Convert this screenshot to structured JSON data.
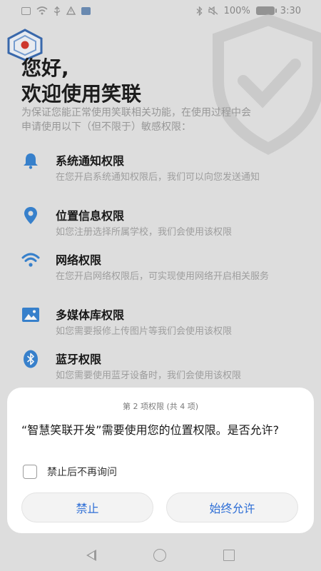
{
  "status_bar": {
    "battery_text": "100%",
    "time": "3:30"
  },
  "greeting": {
    "line1": "您好,",
    "line2": "欢迎使用笑联"
  },
  "intro_text": "为保证您能正常使用笑联相关功能，在使用过程中会申请使用以下（但不限于）敏感权限：",
  "permissions": [
    {
      "title": "系统通知权限",
      "desc": "在您开启系统通知权限后，我们可以向您发送通知",
      "icon": "bell-icon"
    },
    {
      "title": "位置信息权限",
      "desc": "如您注册选择所属学校，我们会使用该权限",
      "icon": "location-pin-icon"
    },
    {
      "title": "网络权限",
      "desc": "在您开启网络权限后，可实现使用网络开启相关服务",
      "icon": "wifi-icon"
    },
    {
      "title": "多媒体库权限",
      "desc": "如您需要报修上传图片等我们会使用该权限",
      "icon": "image-icon"
    },
    {
      "title": "蓝牙权限",
      "desc": "如您需要使用蓝牙设备时，我们会使用该权限",
      "icon": "bluetooth-icon"
    }
  ],
  "dialog": {
    "counter": "第 2 项权限 (共 4 项)",
    "message": "“智慧笑联开发”需要使用您的位置权限。是否允许?",
    "checkbox_label": "禁止后不再询问",
    "deny_label": "禁止",
    "allow_label": "始终允许"
  },
  "colors": {
    "accent": "#2f6fd6",
    "icon_blue": "#3a86d4"
  }
}
